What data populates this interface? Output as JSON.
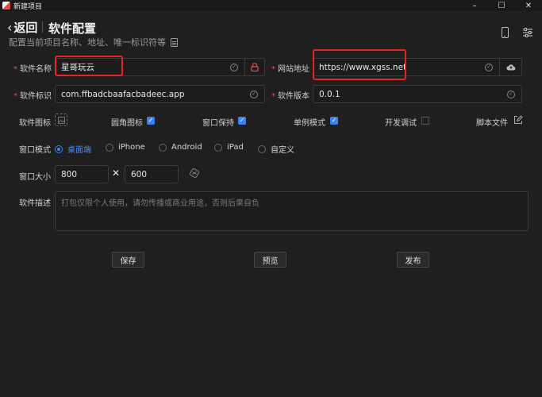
{
  "window": {
    "title": "新建项目",
    "minimize": "–",
    "maximize": "☐",
    "close": "✕"
  },
  "header": {
    "back_chevron": "‹",
    "back_label": "返回",
    "title": "软件配置",
    "subtitle": "配置当前项目名称、地址、唯一标识符等"
  },
  "form": {
    "name": {
      "label": "软件名称",
      "value": "星哥玩云"
    },
    "url": {
      "label": "网站地址",
      "value": "https://www.xgss.net"
    },
    "identifier": {
      "label": "软件标识",
      "value": "com.ffbadcbaafacbadeec.app"
    },
    "version": {
      "label": "软件版本",
      "value": "0.0.1"
    },
    "required_mark": "*",
    "check_glyph": "✓",
    "icon_label": "软件图标",
    "rounded_icon": {
      "label": "圆角图标",
      "checked": true
    },
    "keep_window": {
      "label": "窗口保持",
      "checked": true
    },
    "single_instance": {
      "label": "单例模式",
      "checked": true
    },
    "dev_debug": {
      "label": "开发调试",
      "checked": false
    },
    "script_file": {
      "label": "脚本文件"
    },
    "window_mode": {
      "label": "窗口模式",
      "options": [
        "桌面端",
        "iPhone",
        "Android",
        "iPad",
        "自定义"
      ],
      "selected": "桌面端"
    },
    "window_size": {
      "label": "窗口大小",
      "width": "800",
      "times": "✕",
      "height": "600"
    },
    "description": {
      "label": "软件描述",
      "placeholder": "打包仅限个人使用，请勿传播或商业用途，否则后果自负"
    }
  },
  "buttons": {
    "save": "保存",
    "preview": "预览",
    "publish": "发布"
  },
  "colors": {
    "accent": "#3b82f6",
    "highlight": "#e8222b",
    "required": "#e05050",
    "background": "#1f1f1f"
  }
}
